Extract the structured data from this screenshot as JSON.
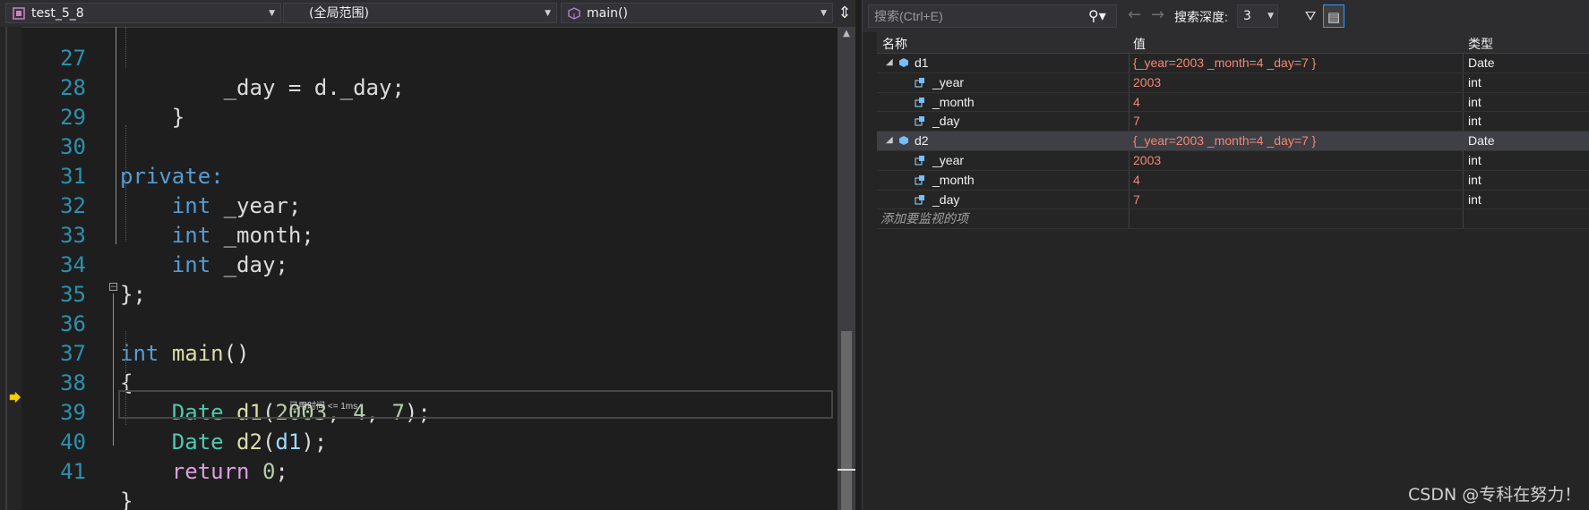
{
  "editor": {
    "project_dropdown": "test_5_8",
    "scope_dropdown": "(全局范围)",
    "function_dropdown": "main()",
    "perf_tip": "已用时间 <= 1ms",
    "lines": [
      {
        "n": "27",
        "code": "        _day = d._day;"
      },
      {
        "n": "28",
        "code": "    }"
      },
      {
        "n": "29",
        "code": ""
      },
      {
        "n": "30",
        "code": "private:"
      },
      {
        "n": "31",
        "code": "    int _year;"
      },
      {
        "n": "32",
        "code": "    int _month;"
      },
      {
        "n": "33",
        "code": "    int _day;"
      },
      {
        "n": "34",
        "code": "};"
      },
      {
        "n": "35",
        "code": ""
      },
      {
        "n": "36",
        "code": "int main()"
      },
      {
        "n": "37",
        "code": "{"
      },
      {
        "n": "38",
        "code": "    Date d1(2003, 4, 7);"
      },
      {
        "n": "39",
        "code": "    Date d2(d1);"
      },
      {
        "n": "40",
        "code": "    return 0;"
      },
      {
        "n": "41",
        "code": "}"
      }
    ]
  },
  "watch": {
    "search_placeholder": "搜索(Ctrl+E)",
    "depth_label": "搜索深度:",
    "depth_value": "3",
    "columns": {
      "name": "名称",
      "value": "值",
      "type": "类型"
    },
    "items": [
      {
        "name": "d1",
        "value": "{_year=2003 _month=4 _day=7 }",
        "type": "Date",
        "expanded": true,
        "children": [
          {
            "name": "_year",
            "value": "2003",
            "type": "int"
          },
          {
            "name": "_month",
            "value": "4",
            "type": "int"
          },
          {
            "name": "_day",
            "value": "7",
            "type": "int"
          }
        ]
      },
      {
        "name": "d2",
        "value": "{_year=2003 _month=4 _day=7 }",
        "type": "Date",
        "expanded": true,
        "children": [
          {
            "name": "_year",
            "value": "2003",
            "type": "int"
          },
          {
            "name": "_month",
            "value": "4",
            "type": "int"
          },
          {
            "name": "_day",
            "value": "7",
            "type": "int"
          }
        ]
      }
    ],
    "add_placeholder": "添加要监视的项"
  },
  "credit": "CSDN @专科在努力！",
  "colors": {
    "accent": "#3399ff",
    "value_text": "#f48771",
    "line_number": "#2b91af"
  }
}
